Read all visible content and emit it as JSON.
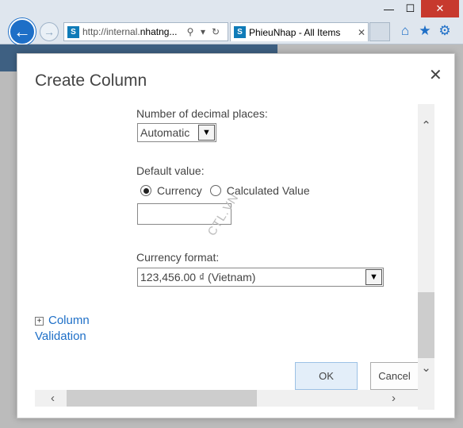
{
  "window": {
    "minimize_glyph": "—",
    "maximize_glyph": "☐",
    "close_glyph": "✕"
  },
  "browser": {
    "back_icon": "back-arrow-icon",
    "forward_icon": "forward-arrow-icon",
    "address": {
      "url_prefix": "http://internal.",
      "url_domain": "nhatng...",
      "site_icon": "sharepoint-icon"
    },
    "tab": {
      "title": "PhieuNhap - All Items",
      "close_glyph": "✕"
    },
    "toolbar_icons": [
      "home-icon",
      "star-icon",
      "gear-icon"
    ]
  },
  "dialog": {
    "title": "Create Column",
    "close_glyph": "✕",
    "decimal_places": {
      "label": "Number of decimal places:",
      "value": "Automatic"
    },
    "default_value": {
      "label": "Default value:",
      "options": [
        "Currency",
        "Calculated Value"
      ],
      "selected": "Currency",
      "input_value": ""
    },
    "currency_format": {
      "label": "Currency format:",
      "value": "123,456.00 ₫ (Vietnam)"
    },
    "column_validation_link": "Column Validation",
    "ok_label": "OK",
    "cancel_label": "Cancel"
  },
  "watermark": "CTL.VN",
  "colors": {
    "accent": "#1e6fc7",
    "close_red": "#c7392e",
    "ok_button_bg": "#e3eef9"
  }
}
